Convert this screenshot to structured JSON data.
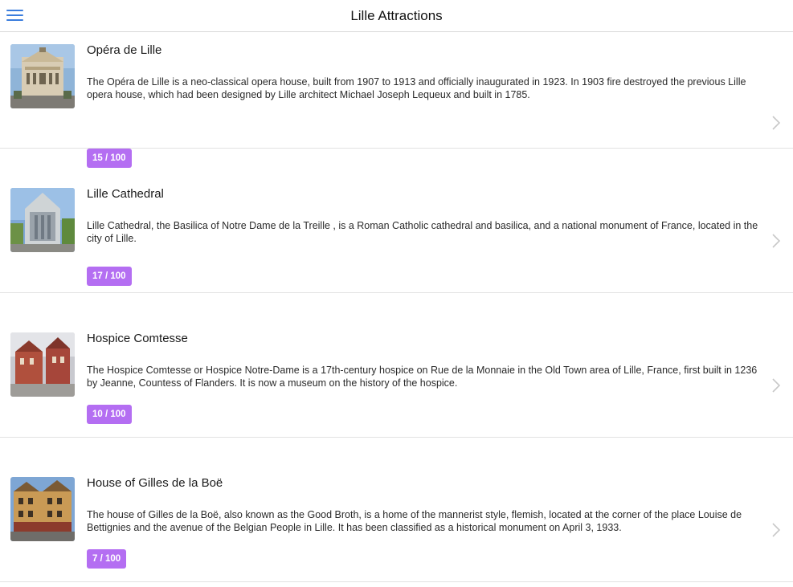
{
  "header": {
    "title": "Lille Attractions",
    "menu_icon": "hamburger-menu-icon"
  },
  "colors": {
    "accent": "#3b7ddd",
    "badge": "#b46ef2",
    "chevron": "#c8c8c8"
  },
  "attractions": [
    {
      "name": "Opéra de Lille",
      "description": "The Opéra de Lille is a neo-classical opera house, built from 1907 to 1913 and officially inaugurated in 1923. In 1903 fire destroyed the previous Lille opera house, which had been designed by Lille architect Michael Joseph Lequeux and built in 1785.",
      "score": "15 / 100",
      "score_value": 15,
      "thumbnail": "opera-house-photo"
    },
    {
      "name": "Lille Cathedral",
      "description": "Lille Cathedral, the Basilica of Notre Dame de la Treille , is a Roman Catholic cathedral and basilica, and a national monument of France, located in the city of Lille.",
      "score": "17 / 100",
      "score_value": 17,
      "thumbnail": "cathedral-photo"
    },
    {
      "name": "Hospice Comtesse",
      "description": "The Hospice Comtesse or Hospice Notre-Dame is a 17th-century hospice on Rue de la Monnaie in the Old Town area of Lille, France, first built in 1236 by Jeanne, Countess of Flanders. It is now a museum on the history of the hospice.",
      "score": "10 / 100",
      "score_value": 10,
      "thumbnail": "hospice-photo"
    },
    {
      "name": "House of Gilles de la Boë",
      "description": "The house of Gilles de la Boë, also known as the Good Broth, is a home of the mannerist style, flemish, located at the corner of the place Louise de Bettignies and the avenue of the Belgian People in Lille. It has been classified as a historical monument on April 3, 1933.",
      "score": "7 / 100",
      "score_value": 7,
      "thumbnail": "house-photo"
    }
  ]
}
